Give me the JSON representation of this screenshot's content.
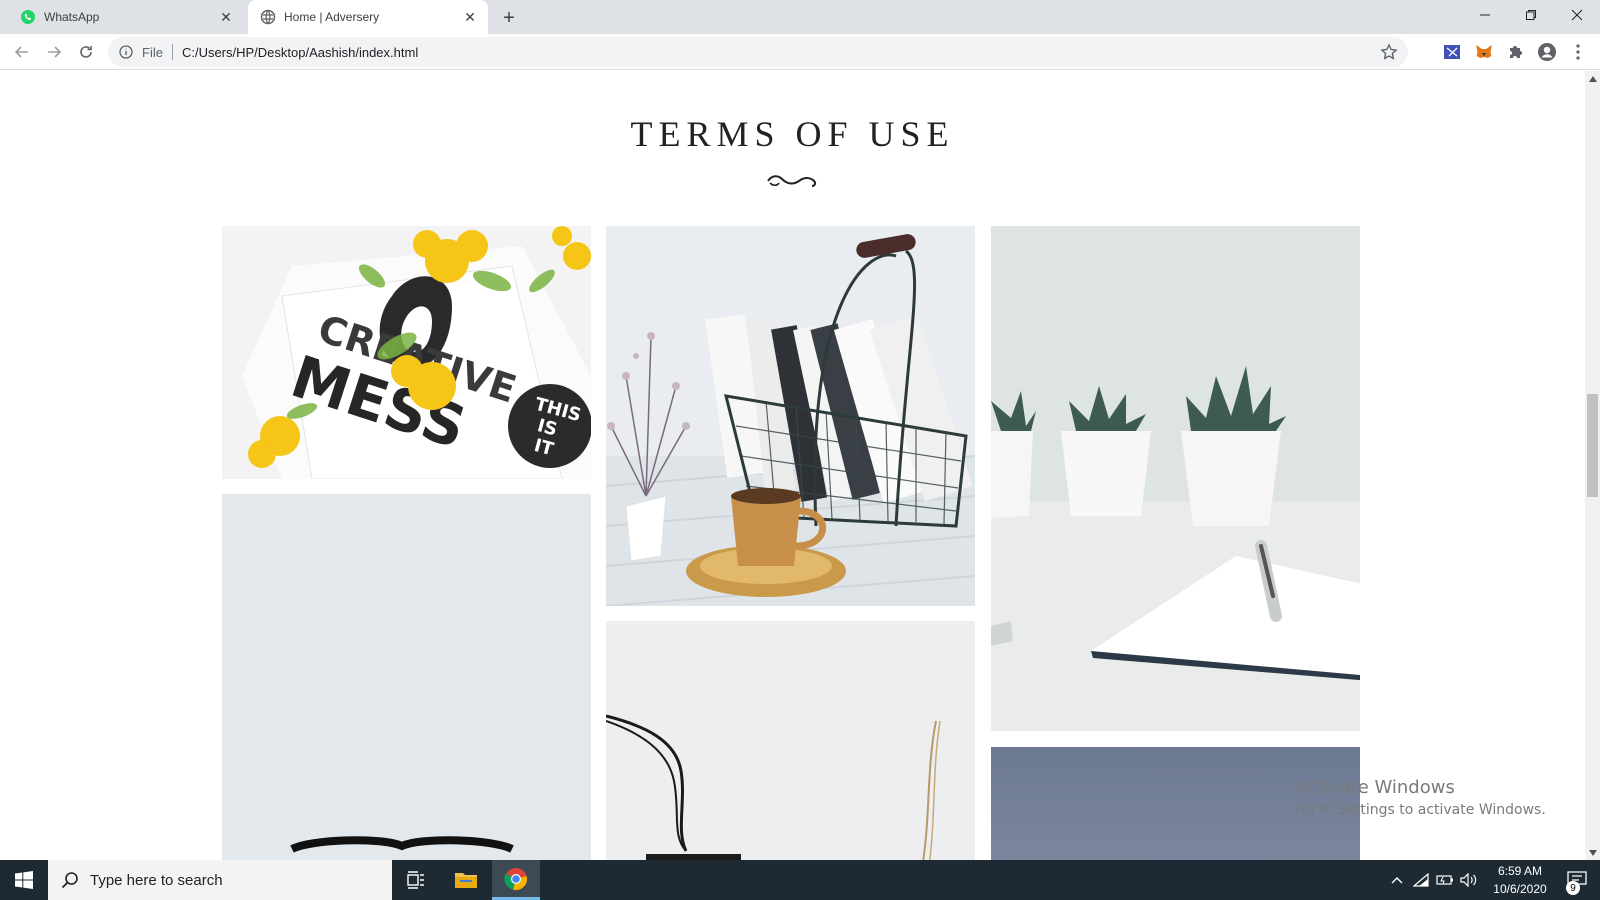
{
  "browser": {
    "tabs": [
      {
        "title": "WhatsApp",
        "favicon": "whatsapp-icon"
      },
      {
        "title": "Home | Adversery",
        "favicon": "globe-icon"
      }
    ],
    "address": {
      "scheme_label": "File",
      "url": "C:/Users/HP/Desktop/Aashish/index.html"
    }
  },
  "page": {
    "heading": "TERMS OF USE"
  },
  "photos": [
    {
      "description": "creative mess notebook with yellow flowers",
      "caption_lines": [
        "CREATIVE",
        "MESS"
      ],
      "sticker": [
        "THIS",
        "IS",
        "IT"
      ]
    },
    {
      "description": "wire basket with books, plant and gold cup"
    },
    {
      "description": "three succulents in white pots with notebook and pen"
    },
    {
      "description": "glasses on light blue background"
    },
    {
      "description": "black cord tag with twine"
    },
    {
      "description": "blue-grey backdrop"
    }
  ],
  "watermark": {
    "title": "Activate Windows",
    "subtitle": "Go to Settings to activate Windows."
  },
  "taskbar": {
    "search_placeholder": "Type here to search",
    "time": "6:59 AM",
    "date": "10/6/2020",
    "notification_count": "9"
  },
  "colors": {
    "tabstrip": "#dee1e6",
    "taskbar": "#1e2a33",
    "heading": "#222222"
  }
}
